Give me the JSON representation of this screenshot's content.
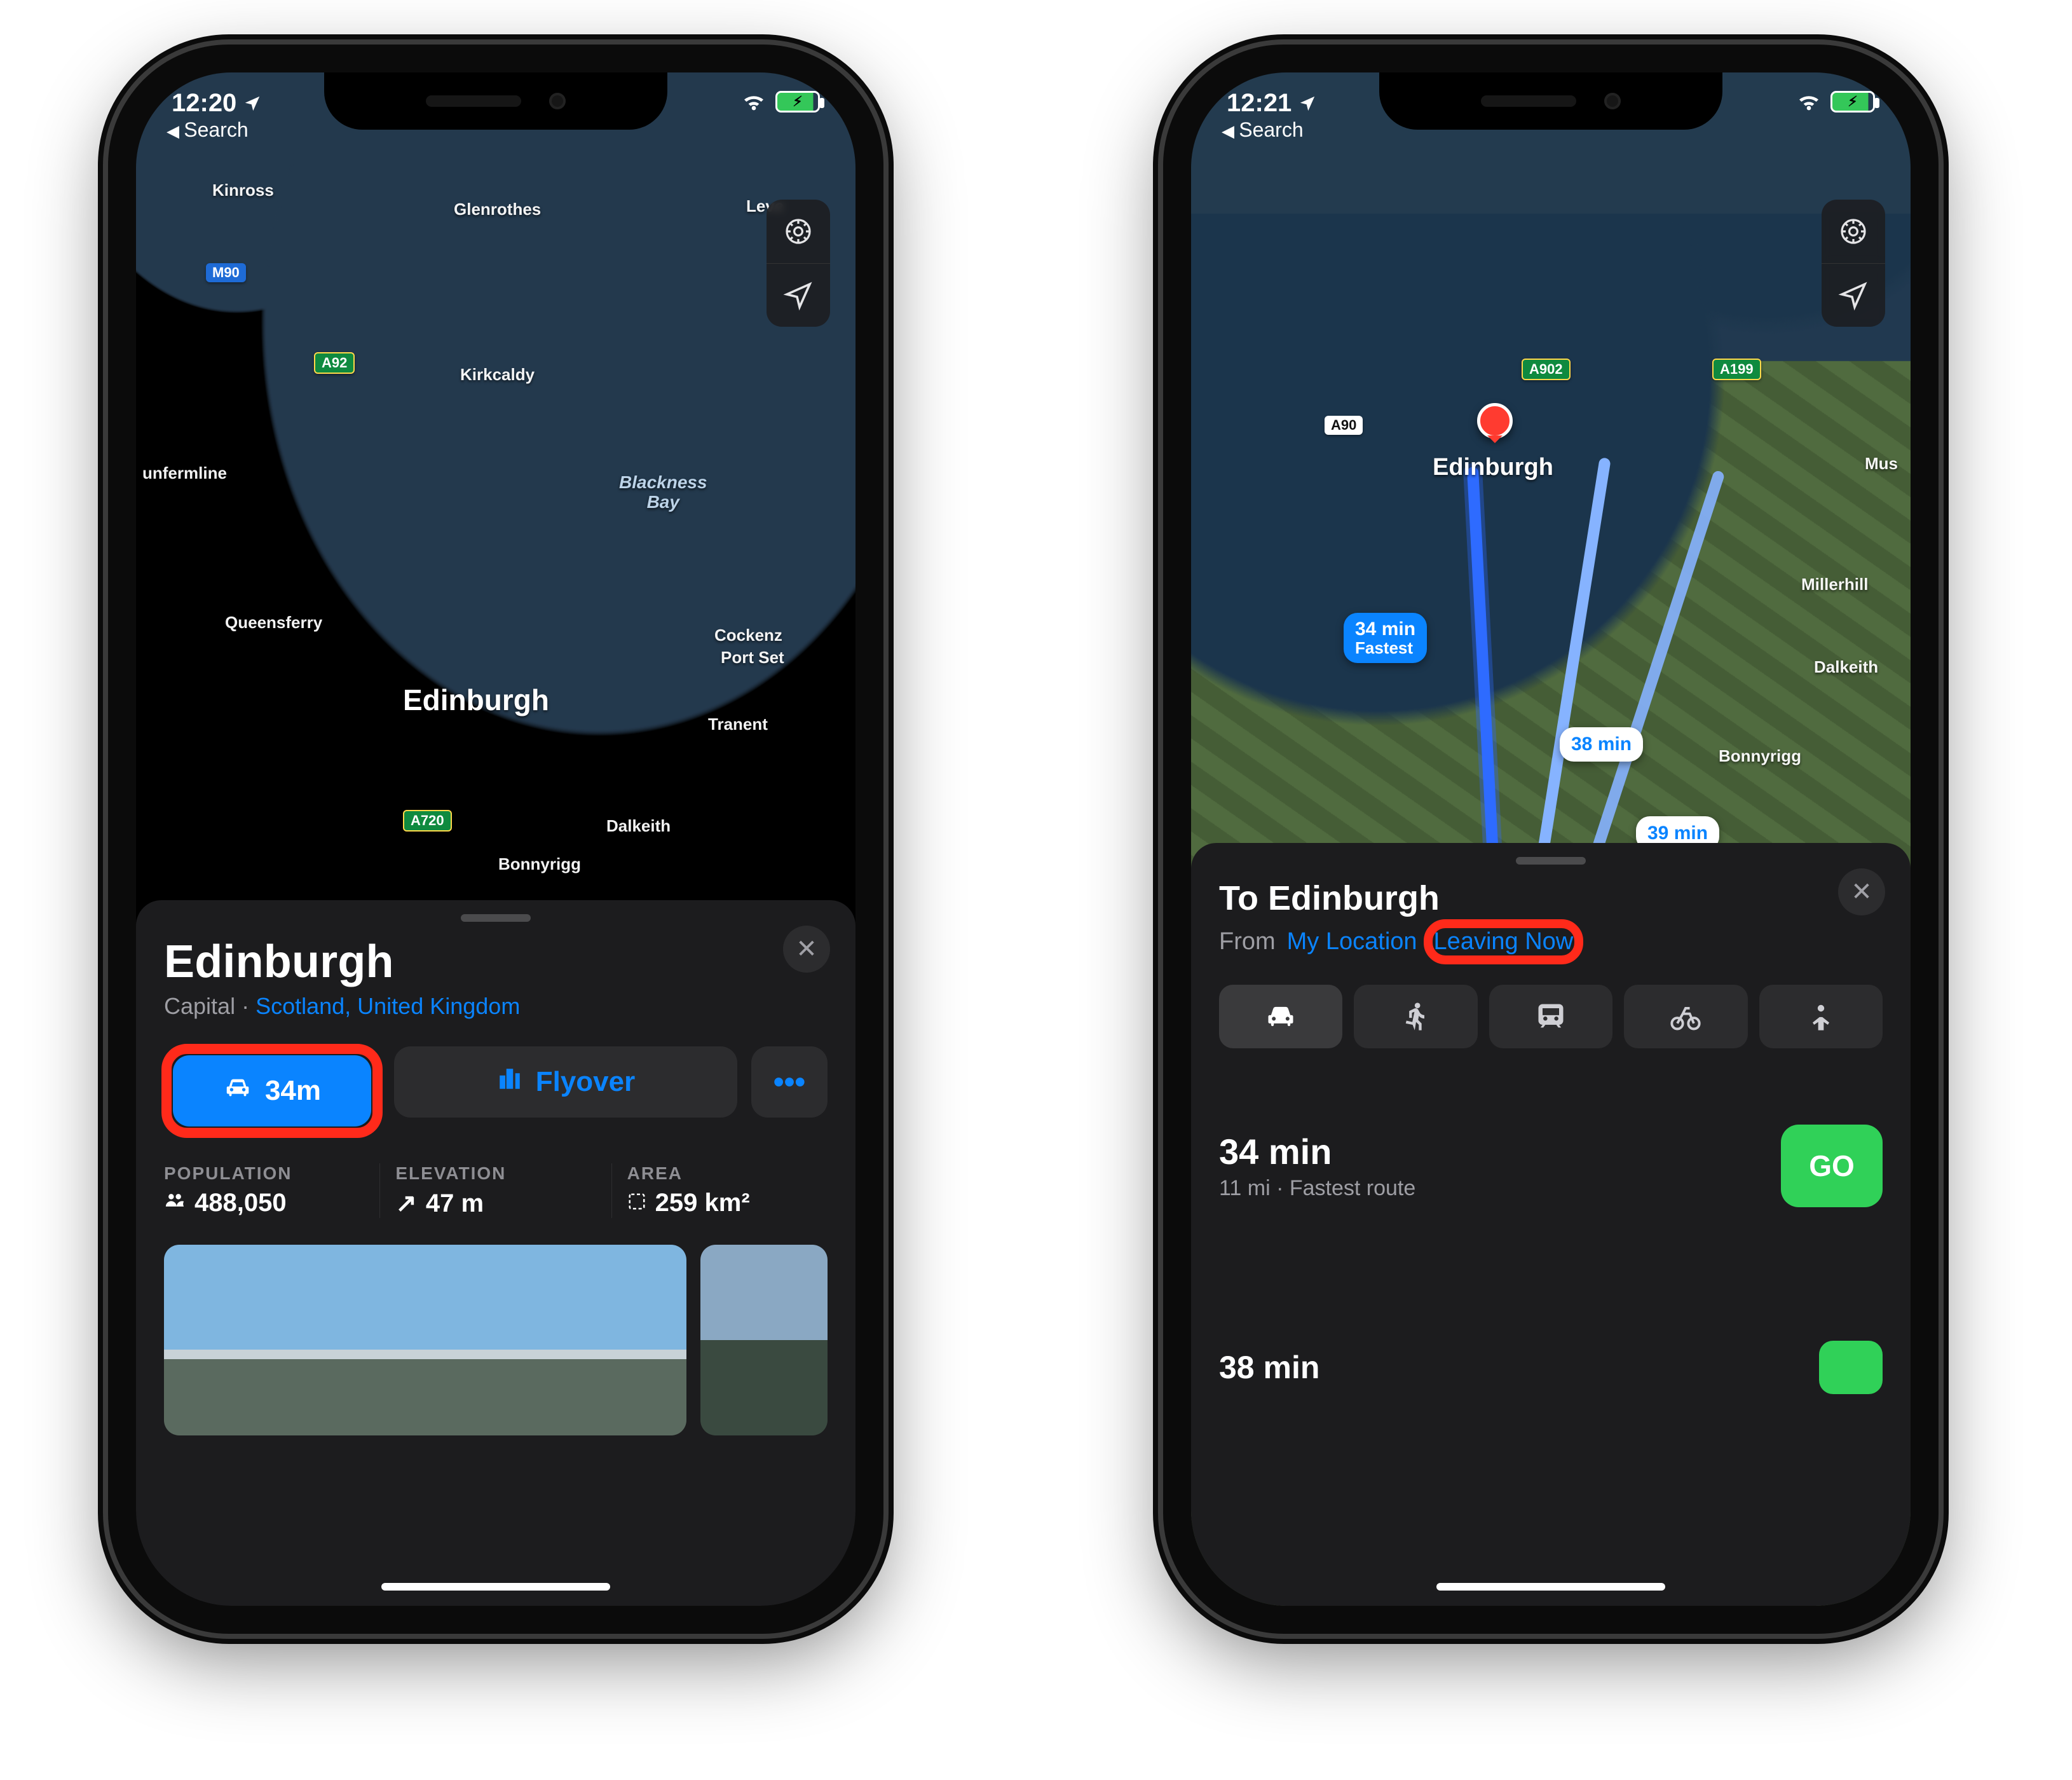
{
  "left": {
    "status": {
      "time": "12:20",
      "back_label": "Search"
    },
    "map": {
      "city": "Edinburgh",
      "sea_label": "Blackness\nBay",
      "small_labels": [
        "Kinross",
        "Glenrothes",
        "Leve",
        "Kirkcaldy",
        "unfermline",
        "Queensferry",
        "Cockenz",
        "Port Set",
        "Tranent",
        "Dalkeith",
        "Bonnyrigg"
      ],
      "roads": {
        "m90": "M90",
        "a92": "A92",
        "a720": "A720"
      }
    },
    "card": {
      "title": "Edinburgh",
      "subtitle_prefix": "Capital · ",
      "subtitle_link": "Scotland, United Kingdom",
      "drive_label": "34m",
      "flyover_label": "Flyover",
      "more_label": "•••",
      "stats": {
        "population": {
          "label": "POPULATION",
          "value": "488,050"
        },
        "elevation": {
          "label": "ELEVATION",
          "value": "47 m"
        },
        "area": {
          "label": "AREA",
          "value": "259 km²"
        }
      }
    }
  },
  "right": {
    "status": {
      "time": "12:21",
      "back_label": "Search"
    },
    "map": {
      "city": "Edinburgh",
      "roads": {
        "a90": "A90",
        "a902": "A902",
        "a199": "A199"
      },
      "small_labels": [
        "Mus",
        "Millerhill",
        "Dalkeith",
        "Bonnyrigg"
      ],
      "callouts": {
        "fastest_time": "34 min",
        "fastest_sub": "Fastest",
        "alt1": "38 min",
        "alt2": "39 min"
      }
    },
    "sheet": {
      "title": "To Edinburgh",
      "from_label": "From",
      "from_value": "My Location",
      "leaving_label": "Leaving Now",
      "modes": [
        "car",
        "walk",
        "transit",
        "bike",
        "rideshare"
      ],
      "route1": {
        "time": "34 min",
        "sub": "11 mi · Fastest route",
        "go": "GO"
      },
      "route2_peek": "38 min"
    }
  }
}
